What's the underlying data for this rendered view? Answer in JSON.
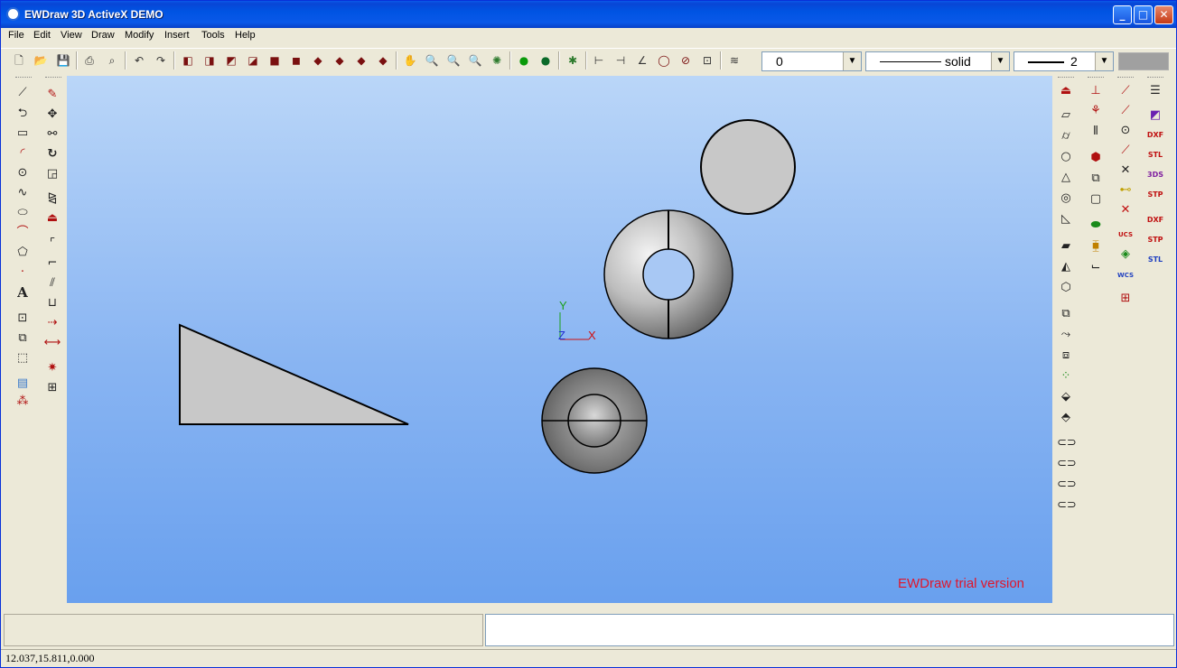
{
  "window": {
    "title": "EWDraw 3D ActiveX DEMO",
    "min_glyph": "_",
    "max_glyph": "□",
    "close_glyph": "✕"
  },
  "menu": [
    "File",
    "Edit",
    "View",
    "Draw",
    "Modify",
    "Insert",
    "Tools",
    "Help"
  ],
  "toolbar": {
    "color_combo_value": "0",
    "linetype_combo_value": "solid",
    "lineweight_combo_value": "2",
    "dropdown_glyph": "▼",
    "swatch_color": "#a0a0a0"
  },
  "viewport": {
    "watermark": "EWDraw trial version",
    "axis_y": "Y",
    "axis_z": "Z",
    "axis_x": "X",
    "bg_top": "#bad6f8",
    "bg_bottom": "#69a0ee"
  },
  "status": {
    "coordinates": "12.037,15.811,0.000"
  },
  "right_labels": {
    "ucs": "UCS",
    "wcs": "WCS",
    "dxf": "DXF",
    "stl": "STL",
    "3ds": "3DS",
    "stp": "STP"
  }
}
